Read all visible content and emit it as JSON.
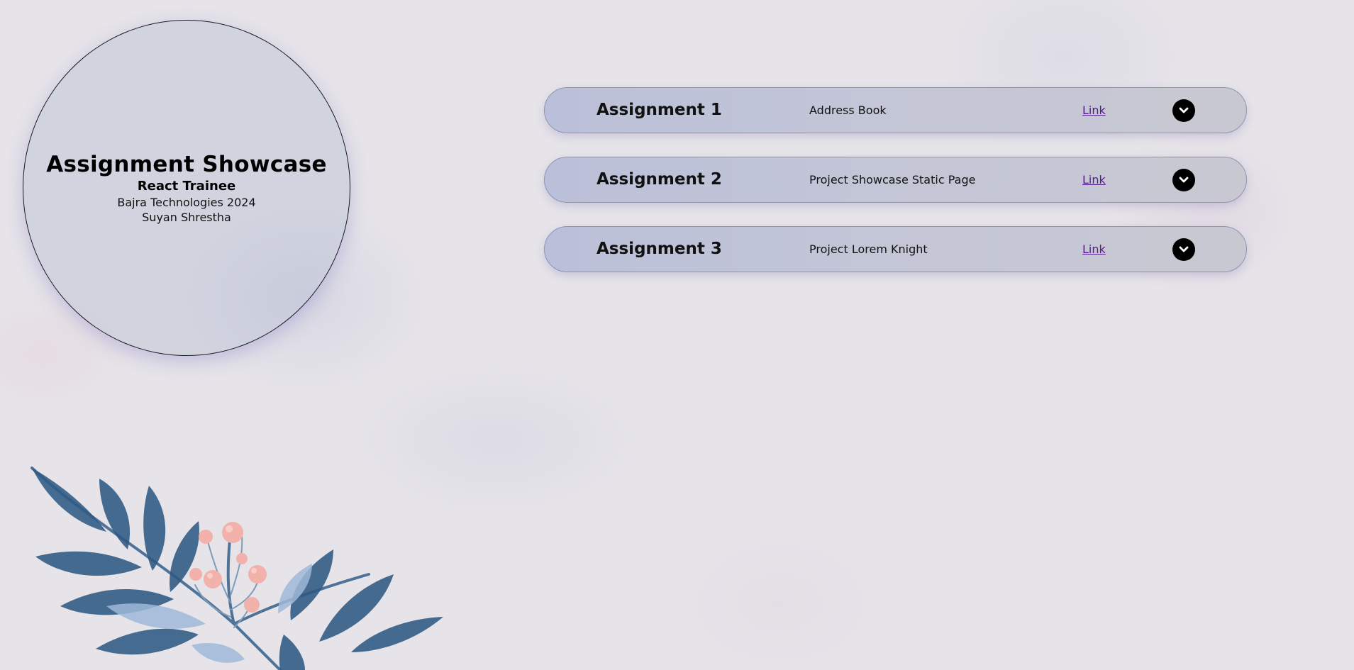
{
  "hero": {
    "title": "Assignment Showcase",
    "subtitle": "React Trainee",
    "organization": "Bajra Technologies 2024",
    "author": "Suyan Shrestha"
  },
  "assignments": [
    {
      "title": "Assignment 1",
      "description": "Address Book",
      "link_label": "Link",
      "toggle_icon": "chevron-down-icon"
    },
    {
      "title": "Assignment 2",
      "description": "Project Showcase Static Page",
      "link_label": "Link",
      "toggle_icon": "chevron-down-icon"
    },
    {
      "title": "Assignment 3",
      "description": "Project Lorem Knight",
      "link_label": "Link",
      "toggle_icon": "chevron-down-icon"
    }
  ],
  "colors": {
    "background": "#e6e4e9",
    "pill_fill": "#bcc1d6",
    "pill_border": "#8e93b6",
    "link": "#551a8b",
    "leaf": "#2f5a84",
    "berry": "#f2b1aa"
  },
  "decoration": {
    "illustration": "watercolor-leaves-and-berries"
  }
}
